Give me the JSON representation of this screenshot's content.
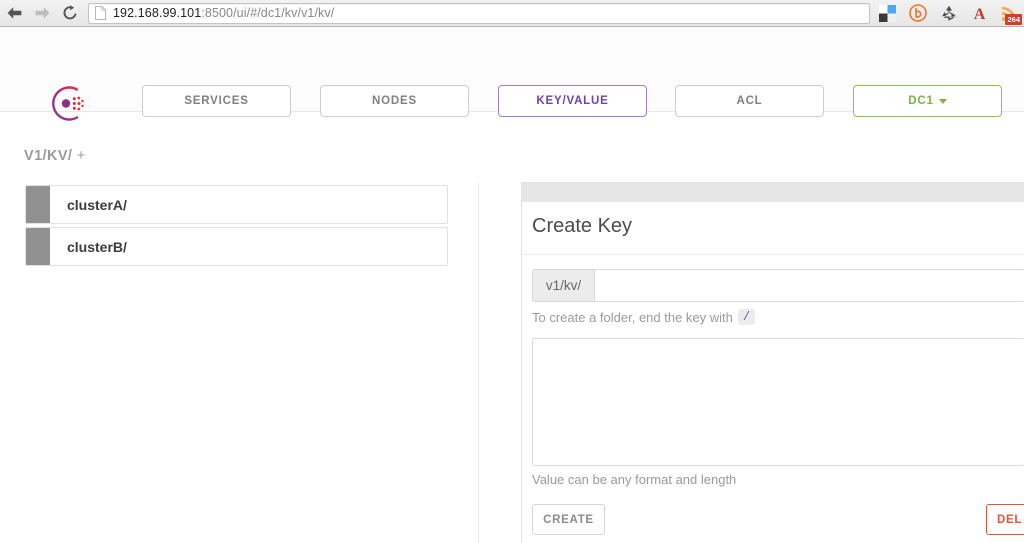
{
  "browser": {
    "back_icon": "back-arrow-icon",
    "forward_icon": "forward-arrow-icon",
    "reload_icon": "reload-icon",
    "page_icon": "page-document-icon",
    "url_host": "192.168.99.101",
    "url_rest": ":8500/ui/#/dc1/kv/v1/kv/",
    "extensions": [
      {
        "name": "color-squares-icon"
      },
      {
        "name": "bitly-b-icon"
      },
      {
        "name": "recycle-icon"
      },
      {
        "name": "letter-a-icon"
      },
      {
        "name": "rss-feed-icon",
        "badge": "264"
      }
    ]
  },
  "app": {
    "logo": "consul-logo-icon",
    "nav": [
      {
        "label": "SERVICES",
        "name": "services"
      },
      {
        "label": "NODES",
        "name": "nodes"
      },
      {
        "label": "KEY/VALUE",
        "name": "key-value"
      },
      {
        "label": "ACL",
        "name": "acl"
      },
      {
        "label": "DC1",
        "name": "datacenter"
      }
    ],
    "colors": {
      "active_nav_border": "#9b7fd4",
      "active_nav_text": "#6f42a8",
      "datacenter_border": "#8bc34a",
      "datacenter_text": "#7cb342",
      "delete_accent": "#e8503a",
      "item_bar": "#919191",
      "code_chip_text": "#7b52b8"
    }
  },
  "breadcrumb": {
    "path": "V1/KV/",
    "add": "+"
  },
  "kv_list": {
    "items": [
      {
        "label": "clusterA/"
      },
      {
        "label": "clusterB/"
      }
    ]
  },
  "detail": {
    "title": "Create Key",
    "key_prefix": "v1/kv/",
    "key_value": "",
    "key_placeholder": "",
    "key_hint_text": "To create a folder, end the key with",
    "key_hint_code": "/",
    "value_text": "",
    "value_placeholder": "",
    "value_hint": "Value can be any format and length",
    "create_label": "CREATE",
    "delete_label": "DEL"
  }
}
